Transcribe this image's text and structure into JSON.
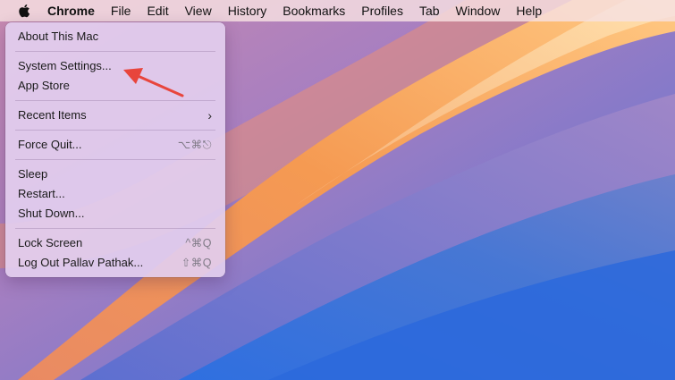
{
  "menubar": {
    "apple_icon": "apple-logo-icon",
    "items": [
      "Chrome",
      "File",
      "Edit",
      "View",
      "History",
      "Bookmarks",
      "Profiles",
      "Tab",
      "Window",
      "Help"
    ]
  },
  "apple_menu": {
    "about": "About This Mac",
    "system_settings": "System Settings...",
    "app_store": "App Store",
    "recent_items": "Recent Items",
    "recent_items_chevron": "›",
    "force_quit": "Force Quit...",
    "force_quit_shortcut": "⌥⌘⎋",
    "sleep": "Sleep",
    "restart": "Restart...",
    "shut_down": "Shut Down...",
    "lock_screen": "Lock Screen",
    "lock_screen_shortcut": "^⌘Q",
    "log_out": "Log Out Pallav Pathak...",
    "log_out_shortcut": "⇧⌘Q"
  },
  "annotation": {
    "arrow_color": "#e8453c",
    "points_to": "system_settings"
  },
  "colors": {
    "menubar_bg": "#f6e0e2",
    "menu_bg": "#e2ceee",
    "wallpaper_orange": "#f39a5a",
    "wallpaper_blue": "#3f6fd2",
    "wallpaper_purple": "#8a73c4"
  }
}
